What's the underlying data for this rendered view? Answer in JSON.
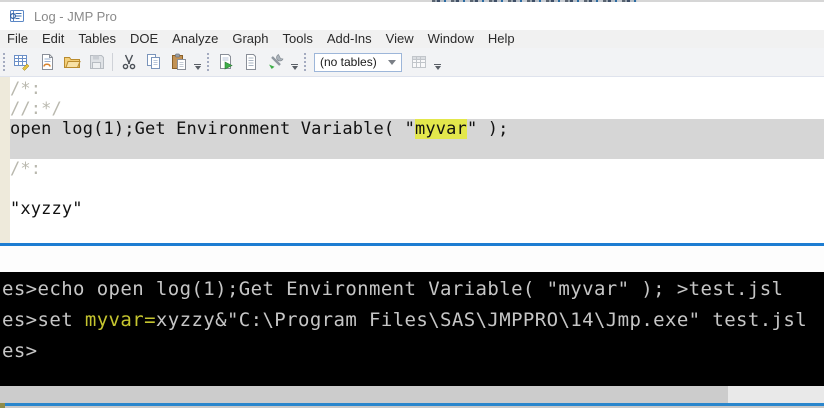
{
  "window": {
    "title": "Log - JMP Pro"
  },
  "menu": {
    "items": [
      "File",
      "Edit",
      "Tables",
      "DOE",
      "Analyze",
      "Graph",
      "Tools",
      "Add-Ins",
      "View",
      "Window",
      "Help"
    ]
  },
  "toolbar": {
    "tables_combobox_value": "(no tables)",
    "icons": [
      "new-data-table",
      "new-script",
      "open-file",
      "save",
      "cut",
      "copy",
      "paste",
      "run-script",
      "view-journal",
      "tools",
      "assign-table"
    ]
  },
  "log": {
    "comment_open": "/*:",
    "comment_close": "//:*/",
    "code_before": "open log(1);Get Environment Variable( \"",
    "code_highlight": "myvar",
    "code_after": "\" );",
    "comment_open2": "/*:",
    "result": "\"xyzzy\""
  },
  "console": {
    "line1": "es>echo open log(1);Get Environment Variable( \"myvar\" ); >test.jsl",
    "line2_prefix": "es>set ",
    "line2_highlight": "myvar=",
    "line2_suffix": "xyzzy&\"C:\\Program Files\\SAS\\JMPPRO\\14\\Jmp.exe\" test.jsl",
    "line3_prompt": "es>"
  },
  "colors": {
    "selection_gray": "#d6d6d6",
    "search_highlight_yellow": "#e3e74c",
    "comment_gray": "#b9b8ae",
    "log_margin_beige": "#eeeadb",
    "window_border_blue": "#1d7dd2",
    "console_text_gray": "#c6c6c6",
    "console_highlight_yellow": "#c5c52f",
    "taskbar_edge_blue": "#2a86cc"
  }
}
